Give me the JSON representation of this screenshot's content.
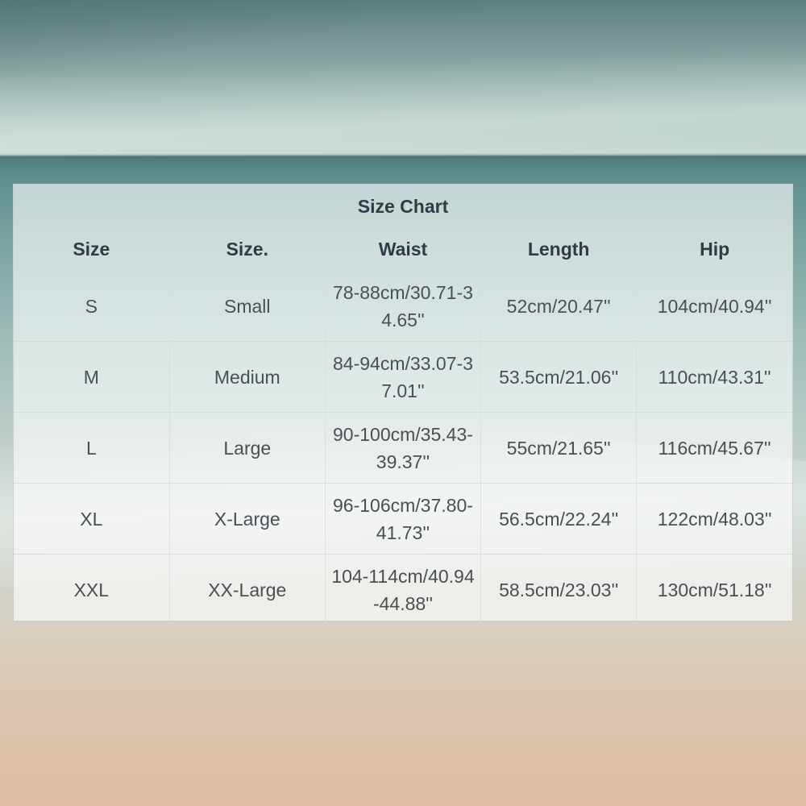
{
  "title": "Size Chart",
  "headers": [
    "Size",
    "Size.",
    "Waist",
    "Length",
    "Hip"
  ],
  "rows": [
    [
      "S",
      "Small",
      "78-88cm/30.71-34.65''",
      "52cm/20.47''",
      "104cm/40.94''"
    ],
    [
      "M",
      "Medium",
      "84-94cm/33.07-37.01''",
      "53.5cm/21.06''",
      "110cm/43.31''"
    ],
    [
      "L",
      "Large",
      "90-100cm/35.43-39.37''",
      "55cm/21.65''",
      "116cm/45.67''"
    ],
    [
      "XL",
      "X-Large",
      "96-106cm/37.80-41.73''",
      "56.5cm/22.24''",
      "122cm/48.03''"
    ],
    [
      "XXL",
      "XX-Large",
      "104-114cm/40.94-44.88''",
      "58.5cm/23.03''",
      "130cm/51.18''"
    ]
  ]
}
